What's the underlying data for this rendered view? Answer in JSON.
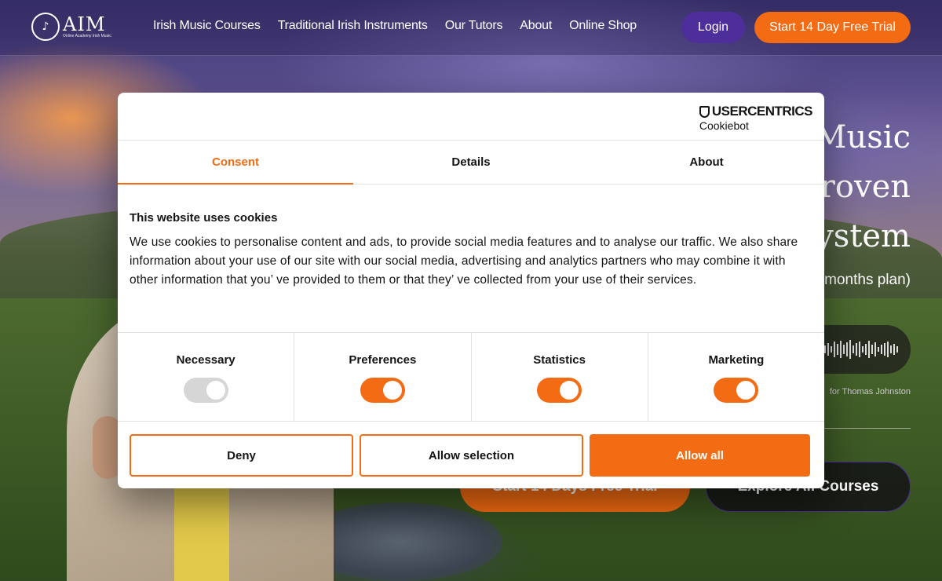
{
  "header": {
    "logo_name": "AIM",
    "logo_sub": "Online Academy Irish Music",
    "nav": [
      "Irish Music Courses",
      "Traditional Irish Instruments",
      "Our Tutors",
      "About",
      "Online Shop"
    ],
    "login_label": "Login",
    "trial_label": "Start 14 Day Free Trial"
  },
  "hero": {
    "line1": "Music",
    "line2": "roven",
    "line3": "ystem",
    "plan": "months plan)",
    "audio_credit": "for Thomas Johnston",
    "trial_label": "Start 14 Days Free Trial",
    "explore_label": "Explore All Courses"
  },
  "cookie_dialog": {
    "brand_name": "USERCENTRICS",
    "brand_sub": "Cookiebot",
    "tabs": [
      "Consent",
      "Details",
      "About"
    ],
    "active_tab": "Consent",
    "title": "This website uses cookies",
    "text": "We use cookies to personalise content and ads, to provide social media features and to analyse our traffic. We also share information about your use of our site with our social media, advertising and analytics partners who may combine it with other information that you’ ve provided to them or that they’ ve collected from your use of their services.",
    "toggles": [
      {
        "label": "Necessary",
        "on": true,
        "disabled": true
      },
      {
        "label": "Preferences",
        "on": true,
        "disabled": false
      },
      {
        "label": "Statistics",
        "on": true,
        "disabled": false
      },
      {
        "label": "Marketing",
        "on": true,
        "disabled": false
      }
    ],
    "buttons": {
      "deny": "Deny",
      "allow_selection": "Allow selection",
      "allow_all": "Allow all"
    }
  },
  "colors": {
    "accent": "#f36b12",
    "login_purple": "#4d2e9b",
    "text": "#141414"
  }
}
